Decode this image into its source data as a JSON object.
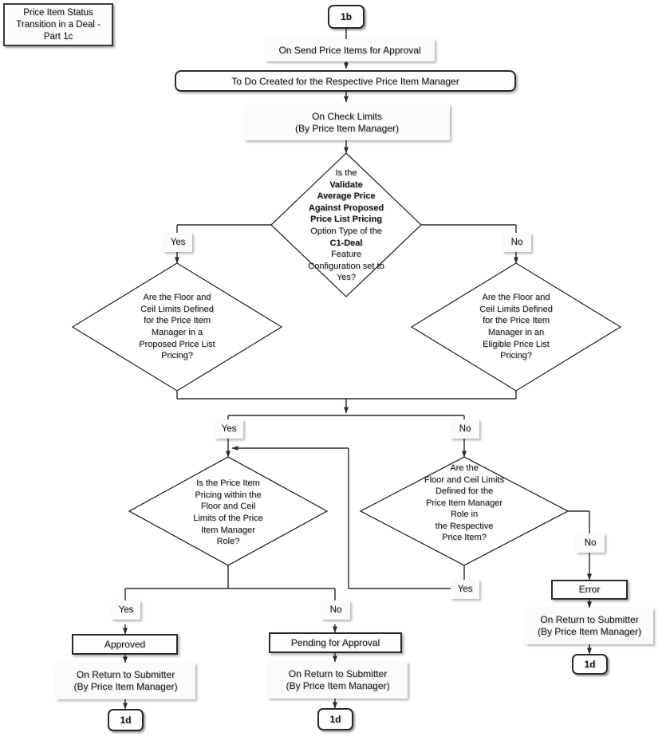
{
  "diagram": {
    "title": "Price Item Status Transition in a Deal - Part 1c",
    "type": "flowchart"
  },
  "nodes": {
    "title_box": {
      "label": "Price Item Status Transition in a Deal - Part 1c"
    },
    "start": {
      "label": "1b"
    },
    "ev_send": {
      "line1": "On Send Price Items for Approval",
      "line2": ""
    },
    "todo": {
      "label": "To Do Created for the Respective Price Item Manager"
    },
    "ev_check": {
      "line1": "On Check Limits",
      "line2": "(By Price Item Manager)"
    },
    "d_validate": {
      "text": "Is the Validate Average Price Against Proposed Price List Pricing Option Type of the C1-Deal Feature Configuration set to Yes?",
      "seg1": "Is the ",
      "seg2": "Validate",
      "seg3": "Average Price",
      "seg4": "Against Proposed",
      "seg5": "Price List Pricing",
      "seg6": "Option Type of the",
      "seg7": "C1-Deal",
      "seg8": " Feature",
      "seg9": "Configuration set to",
      "seg10": "Yes?"
    },
    "d_proposed": {
      "text": "Are the Floor and Ceil Limits Defined for the Price Item Manager in a Proposed Price List Pricing?",
      "l1": "Are the Floor and",
      "l2": "Ceil Limits Defined",
      "l3": "for the Price Item",
      "l4": "Manager in a",
      "l5": "Proposed Price List",
      "l6": "Pricing?"
    },
    "d_eligible": {
      "text": "Are the Floor and Ceil Limits Defined for the Price Item Manager in an Eligible Price List Pricing?",
      "l1": "Are the Floor and",
      "l2": "Ceil Limits Defined",
      "l3": "for the Price Item",
      "l4": "Manager in an",
      "l5": "Eligible Price List",
      "l6": "Pricing?"
    },
    "d_within": {
      "text": "Is the Price Item Pricing within the Floor and Ceil Limits of the Price Item Manager Role?",
      "l1": "Is the Price Item",
      "l2": "Pricing within the",
      "l3": "Floor and Ceil",
      "l4": "Limits of the Price",
      "l5": "Item Manager",
      "l6": "Role?"
    },
    "d_role": {
      "text": "Are the Floor and Ceil Limits Defined for the Price Item Manager Role in the Respective Price Item?",
      "l1": "Are the",
      "l2": "Floor and Ceil Limits",
      "l3": "Defined for the",
      "l4": "Price Item Manager",
      "l5": "Role in",
      "l6": "the Respective",
      "l7": "Price Item?"
    },
    "approved": {
      "label": "Approved"
    },
    "pending": {
      "label": "Pending for Approval"
    },
    "error": {
      "label": "Error"
    },
    "ev_return_left": {
      "line1": "On Return to Submitter",
      "line2": "(By Price Item Manager)"
    },
    "ev_return_mid": {
      "line1": "On Return to Submitter",
      "line2": "(By Price Item Manager)"
    },
    "ev_return_right": {
      "line1": "On Return to Submitter",
      "line2": "(By Price Item Manager)"
    },
    "end_left": {
      "label": "1d"
    },
    "end_mid": {
      "label": "1d"
    },
    "end_right": {
      "label": "1d"
    }
  },
  "branch_labels": {
    "validate_yes": "Yes",
    "validate_no": "No",
    "merge_yes": "Yes",
    "merge_no": "No",
    "within_yes": "Yes",
    "within_no": "No",
    "role_yes": "Yes",
    "role_no": "No"
  },
  "colors": {
    "stroke": "#2b2b2b",
    "line": "#3a3a3a",
    "text": "#1a1a1a",
    "fill": "#fdfdfd",
    "page": "#ffffff"
  }
}
